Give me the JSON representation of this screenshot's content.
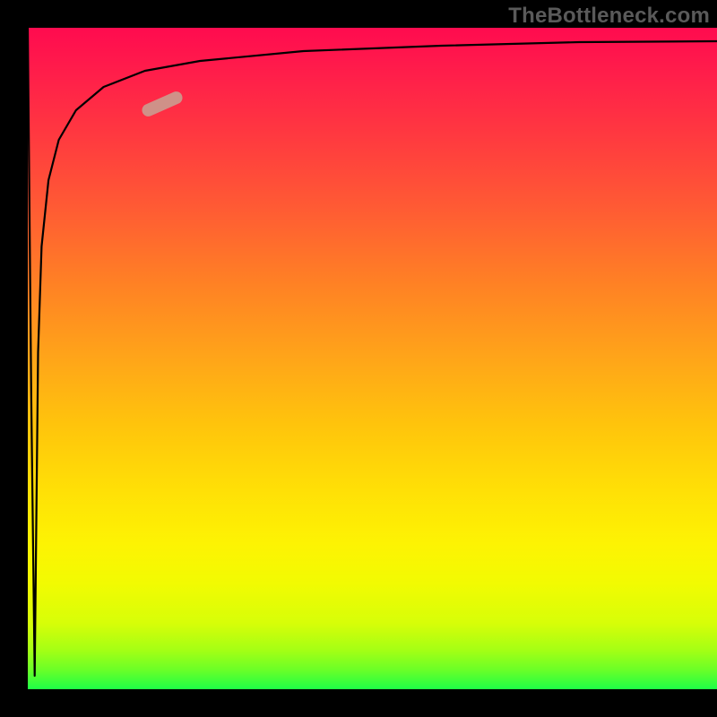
{
  "attribution": "TheBottleneck.com",
  "chart_data": {
    "type": "line",
    "title": "",
    "xlabel": "",
    "ylabel": "",
    "xlim": [
      0,
      100
    ],
    "ylim": [
      0,
      100
    ],
    "series": [
      {
        "name": "curve",
        "x": [
          0.0,
          0.5,
          1.0,
          1.5,
          2.0,
          3.0,
          4.5,
          7.0,
          11.0,
          17.0,
          25.0,
          40.0,
          60.0,
          80.0,
          100.0
        ],
        "y": [
          100.0,
          45.0,
          2.0,
          51.0,
          67.0,
          77.0,
          83.0,
          87.5,
          91.0,
          93.5,
          95.0,
          96.5,
          97.3,
          97.8,
          98.0
        ]
      }
    ],
    "marker": {
      "on_series": "curve",
      "x": 17.0,
      "y": 88.5,
      "color": "#cf9188"
    },
    "background": {
      "gradient_axis": "y",
      "stops": [
        {
          "y": 100,
          "color": "#ff0b4f"
        },
        {
          "y": 50,
          "color": "#ffa519"
        },
        {
          "y": 20,
          "color": "#fdf303"
        },
        {
          "y": 0,
          "color": "#1eff47"
        }
      ]
    }
  }
}
